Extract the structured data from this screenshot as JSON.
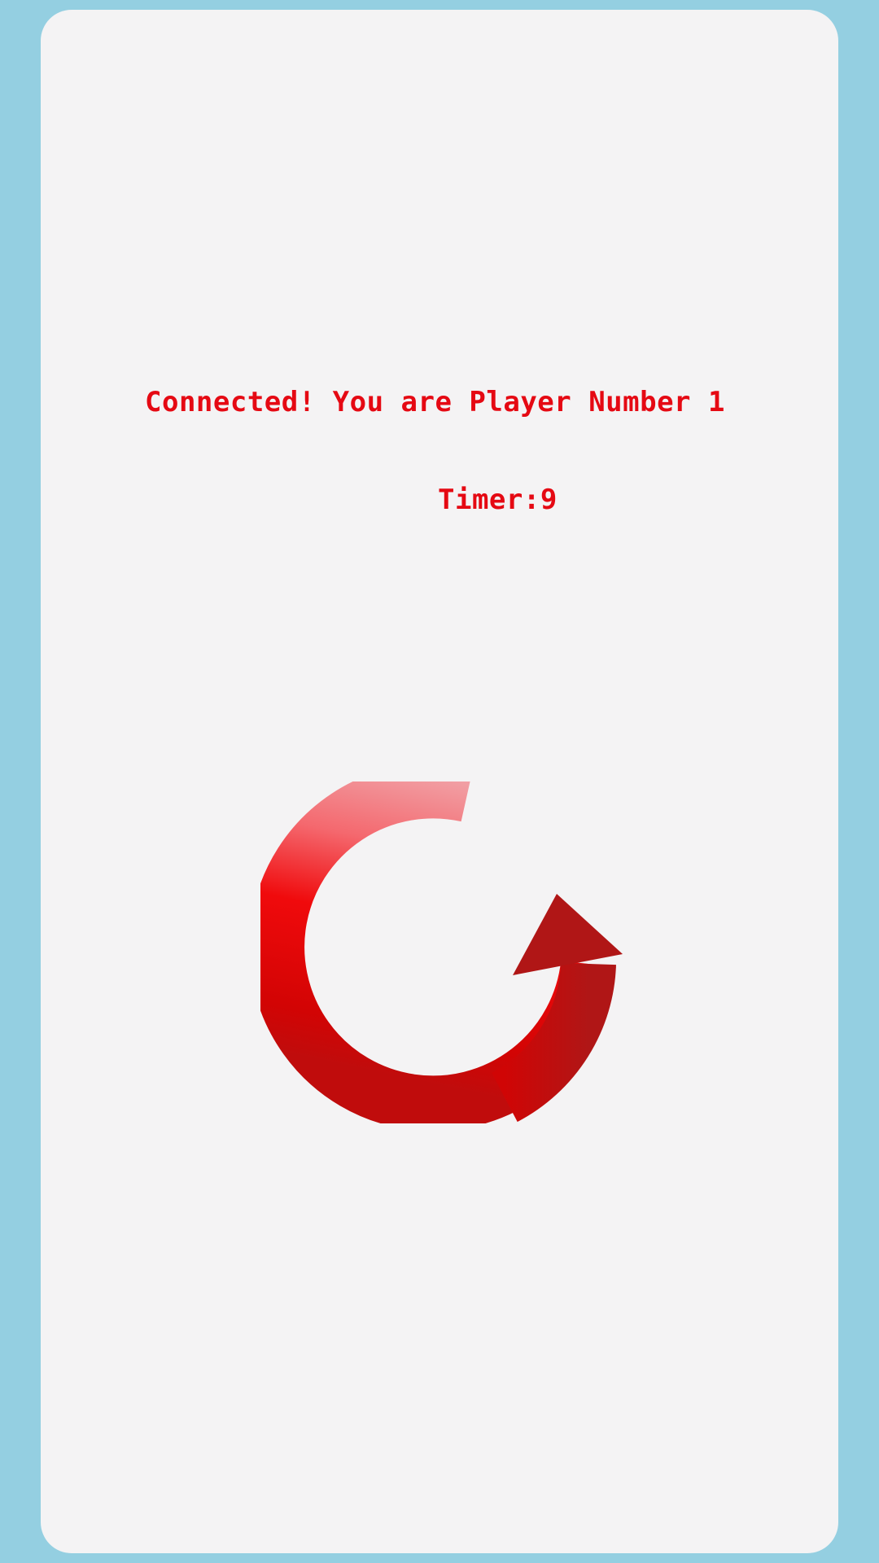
{
  "status": {
    "connected_text": "Connected! You are Player Number 1",
    "timer_text": "Timer:9"
  },
  "icons": {
    "refresh": "refresh-arrow-icon"
  },
  "colors": {
    "background": "#94cfe1",
    "card": "#f4f3f4",
    "text": "#e50913",
    "arrow_light": "#f1a0a5",
    "arrow_mid": "#f00a0c",
    "arrow_dark": "#b01616"
  }
}
